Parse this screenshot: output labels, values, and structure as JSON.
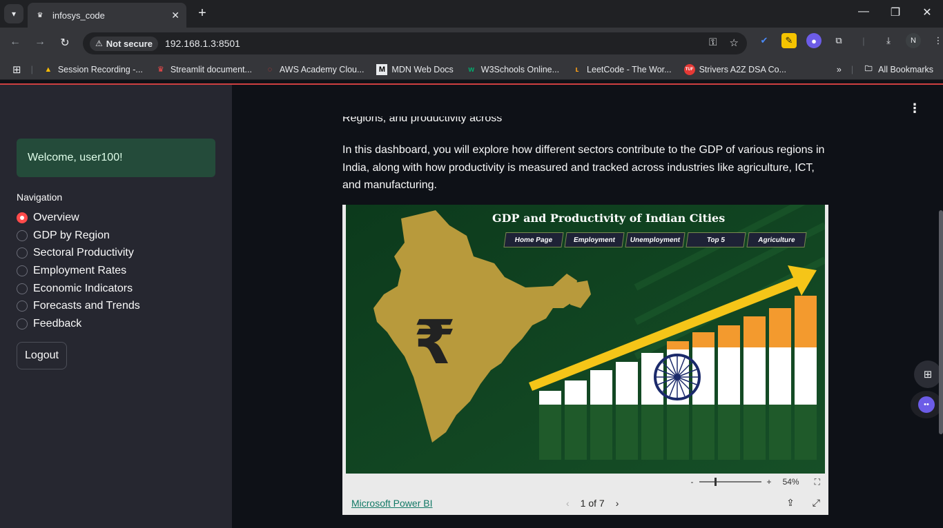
{
  "browser": {
    "tab_title": "infosys_code",
    "security_label": "Not secure",
    "url": "192.168.1.3:8501",
    "profile_initial": "N",
    "bookmarks": [
      {
        "label": "Session Recording -...",
        "icon": "drive-icon"
      },
      {
        "label": "Streamlit document...",
        "icon": "streamlit-icon"
      },
      {
        "label": "AWS Academy Clou...",
        "icon": "aws-icon"
      },
      {
        "label": "MDN Web Docs",
        "icon": "mdn-icon"
      },
      {
        "label": "W3Schools Online...",
        "icon": "w3schools-icon"
      },
      {
        "label": "LeetCode - The Wor...",
        "icon": "leetcode-icon"
      },
      {
        "label": "Strivers A2Z DSA Co...",
        "icon": "tuf-icon"
      }
    ],
    "all_bookmarks_label": "All Bookmarks"
  },
  "sidebar": {
    "welcome": "Welcome, user100!",
    "nav_label": "Navigation",
    "items": [
      {
        "label": "Overview",
        "selected": true
      },
      {
        "label": "GDP by Region",
        "selected": false
      },
      {
        "label": "Sectoral Productivity",
        "selected": false
      },
      {
        "label": "Employment Rates",
        "selected": false
      },
      {
        "label": "Economic Indicators",
        "selected": false
      },
      {
        "label": "Forecasts and Trends",
        "selected": false
      },
      {
        "label": "Feedback",
        "selected": false
      }
    ],
    "logout_label": "Logout"
  },
  "main": {
    "partial_line": "Regions, and productivity across sectors",
    "intro": "In this dashboard, you will explore how different sectors contribute to the GDP of various regions in India, along with how productivity is measured and tracked across industries like agriculture, ICT, and manufacturing.",
    "report": {
      "title": "GDP and Productivity of Indian Cities",
      "buttons": [
        "Home Page",
        "Employment",
        "Unemployment",
        "Top 5",
        "Agriculture"
      ],
      "zoom_minus": "-",
      "zoom_plus": "+",
      "zoom": "54%",
      "powerbi_link": "Microsoft Power BI",
      "page_indicator": "1 of 7"
    }
  },
  "colors": {
    "accent": "#ff4b4b",
    "sidebar_bg": "#262730",
    "main_bg": "#0e1117",
    "welcome_bg": "#244b3a",
    "saffron": "#f39a2e",
    "india_green": "#1f5a2a",
    "map_gold": "#b89a3c"
  }
}
